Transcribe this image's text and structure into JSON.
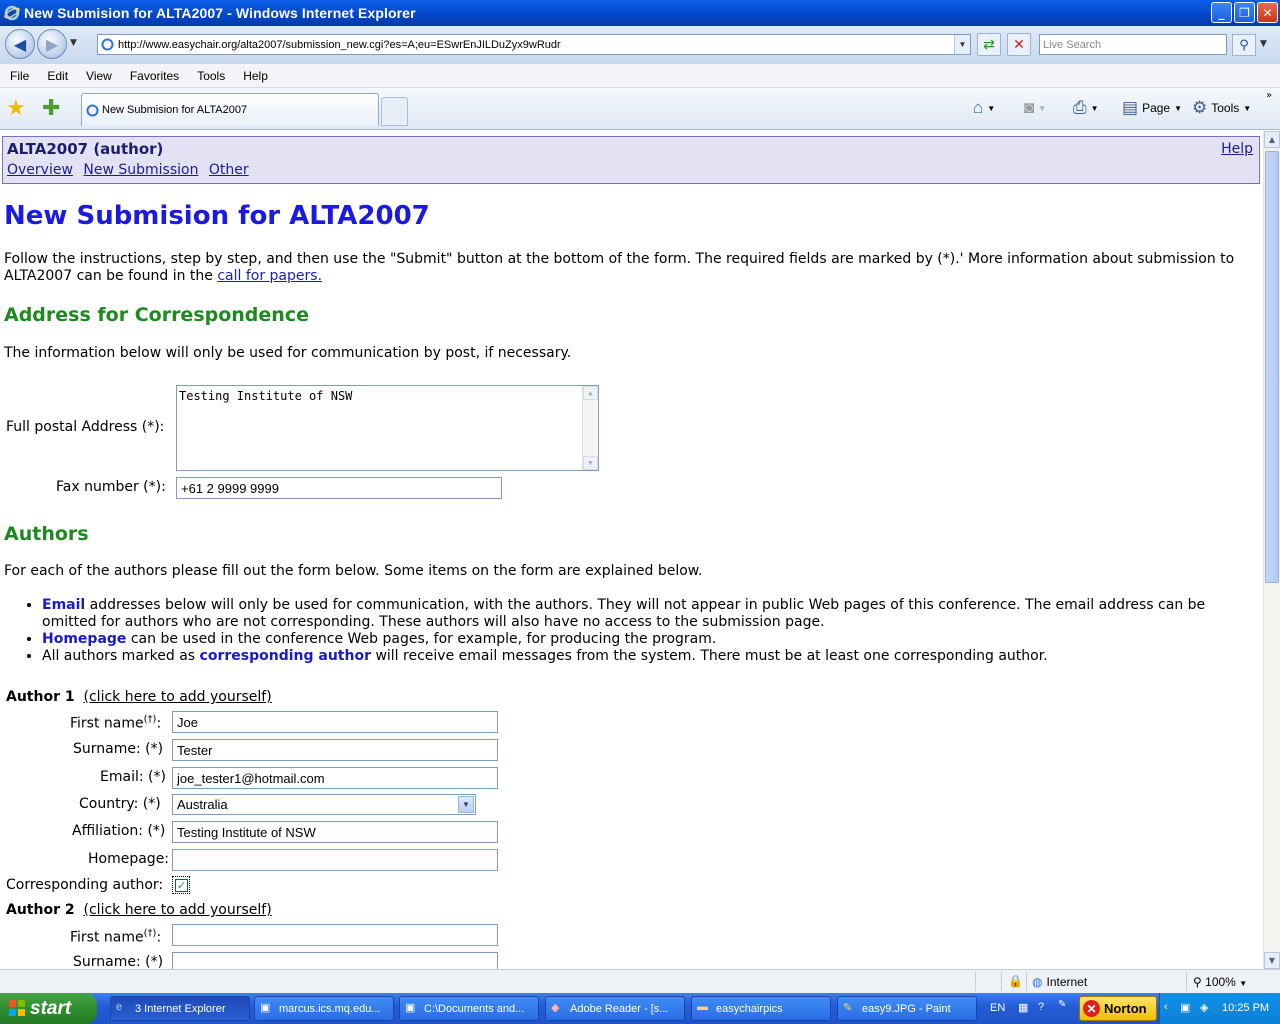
{
  "window": {
    "title": "New Submision for ALTA2007 - Windows Internet Explorer",
    "minimize": "_",
    "restore": "❐",
    "close": "✕"
  },
  "address": {
    "url": "http://www.easychair.org/alta2007/submission_new.cgi?es=A;eu=ESwrEnJILDuZyx9wRudr",
    "search_placeholder": "Live Search"
  },
  "menu": [
    "File",
    "Edit",
    "View",
    "Favorites",
    "Tools",
    "Help"
  ],
  "tab": {
    "title": "New Submision for ALTA2007"
  },
  "toolbar": {
    "page": "Page",
    "tools": "Tools"
  },
  "header": {
    "conference": "ALTA2007 (author)",
    "links": [
      "Overview",
      "New Submission",
      "Other"
    ],
    "help": "Help"
  },
  "page": {
    "title": "New Submision for ALTA2007",
    "intro_line1": "Follow the instructions, step by step, and then use the \"Submit\" button at the bottom of the form. The required fields are marked by (*).' More information about submission to",
    "intro_line2_prefix": "ALTA2007 can be found in the ",
    "intro_link": "call for papers.",
    "address_heading": "Address for Correspondence",
    "address_note": "The information below will only be used for communication by post, if necessary.",
    "postal_label": "Full postal Address (*):",
    "postal_value": "Testing Institute of NSW",
    "fax_label": "Fax number (*):",
    "fax_value": "+61 2 9999 9999",
    "authors_heading": "Authors",
    "authors_note": "For each of the authors please fill out the form below. Some items on the form are explained below.",
    "bullets": {
      "email_term": "Email",
      "email_text1": " addresses below will only be used for communication, with the authors. They will not appear in public Web pages of this conference. The email address can be",
      "email_text2": "omitted for authors who are not corresponding. These authors will also have no access to the submission page.",
      "homepage_term": "Homepage",
      "homepage_text": " can be used in the conference Web pages, for example, for producing the program.",
      "corr_prefix": "All authors marked as ",
      "corr_term": "corresponding author",
      "corr_text": " will receive email messages from the system. There must be at least one corresponding author."
    }
  },
  "author1": {
    "heading": "Author 1",
    "add_self": "(click here to add yourself)",
    "first_name_label": "First name",
    "first_name_sup": "(†)",
    "colon": ":",
    "first_name": "Joe",
    "surname_label": "Surname: (*)",
    "surname": "Tester",
    "email_label": "Email: (*)",
    "email": "joe_tester1@hotmail.com",
    "country_label": "Country: (*)",
    "country": "Australia",
    "affiliation_label": "Affiliation: (*)",
    "affiliation": "Testing Institute of NSW",
    "homepage_label": "Homepage:",
    "homepage": "",
    "corresponding_label": "Corresponding author:",
    "corresponding_checked": true,
    "check_glyph": "✓"
  },
  "author2": {
    "heading": "Author 2",
    "add_self": "(click here to add yourself)",
    "first_name_label": "First name",
    "first_name_sup": "(†)",
    "colon": ":",
    "surname_label": "Surname: (*)"
  },
  "status": {
    "zone": "Internet",
    "zoom": "100%"
  },
  "taskbar": {
    "start": "start",
    "items": [
      "3 Internet Explorer",
      "marcus.ics.mq.edu...",
      "C:\\Documents and...",
      "Adobe Reader - [s...",
      "easychairpics",
      "easy9.JPG - Paint"
    ],
    "lang": "EN",
    "norton": "Norton",
    "clock": "10:25 PM"
  },
  "colors": {
    "link_blue": "#1d1d8d",
    "heading_green": "#1c8a1c",
    "title_blue": "#1a1ae0",
    "header_box": "#e2e2f4"
  }
}
